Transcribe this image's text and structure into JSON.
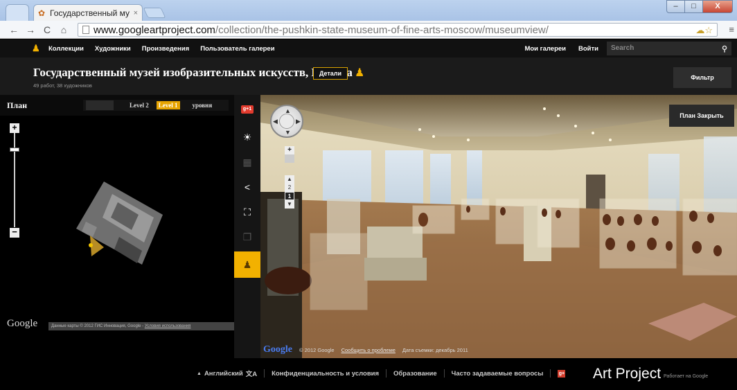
{
  "browser": {
    "tab_title": "Государственный му",
    "tab_close": "×",
    "url_host": "www.googleartproject.com",
    "url_path": "/collection/the-pushkin-state-museum-of-fine-arts-moscow/museumview/",
    "window_min": "–",
    "window_max": "□",
    "window_close": "X"
  },
  "site_nav": {
    "links": [
      "Коллекции",
      "Художники",
      "Произведения",
      "Пользователь галереи"
    ],
    "my_galleries": "Мои галереи",
    "sign_in": "Войти",
    "search_placeholder": "Search"
  },
  "museum": {
    "title": "Государственный музей изобразительных искусств, Москва",
    "subtitle": "49 работ, 38 художников",
    "details_label": "Детали",
    "filter_label": "Фильтр"
  },
  "map": {
    "title": "План",
    "level_2": "Level 2",
    "level_1": "Level 1",
    "levels_label": "уровня",
    "google_logo": "Google",
    "attribution": "Данные карты © 2012 ГИС Инновация, Google - ",
    "terms": "Условия использования"
  },
  "tools": {
    "gplus_badge": "g+1"
  },
  "pano": {
    "map_close_label": "План Закрыть",
    "zoom_plus": "+",
    "floor_2": "2",
    "floor_1": "1",
    "google_logo": "Google",
    "copyright": "© 2012 Google",
    "report": "Сообщить о проблеме",
    "capture_date": "Дата съемки: декабрь 2011"
  },
  "footer": {
    "language": "Английский",
    "privacy": "Конфиденциальность и условия",
    "education": "Образование",
    "faq": "Часто задаваемые вопросы",
    "brand": "Art Project",
    "brand_sub": "Работает на Google"
  },
  "colors": {
    "accent": "#f2b100",
    "background": "#000000"
  }
}
